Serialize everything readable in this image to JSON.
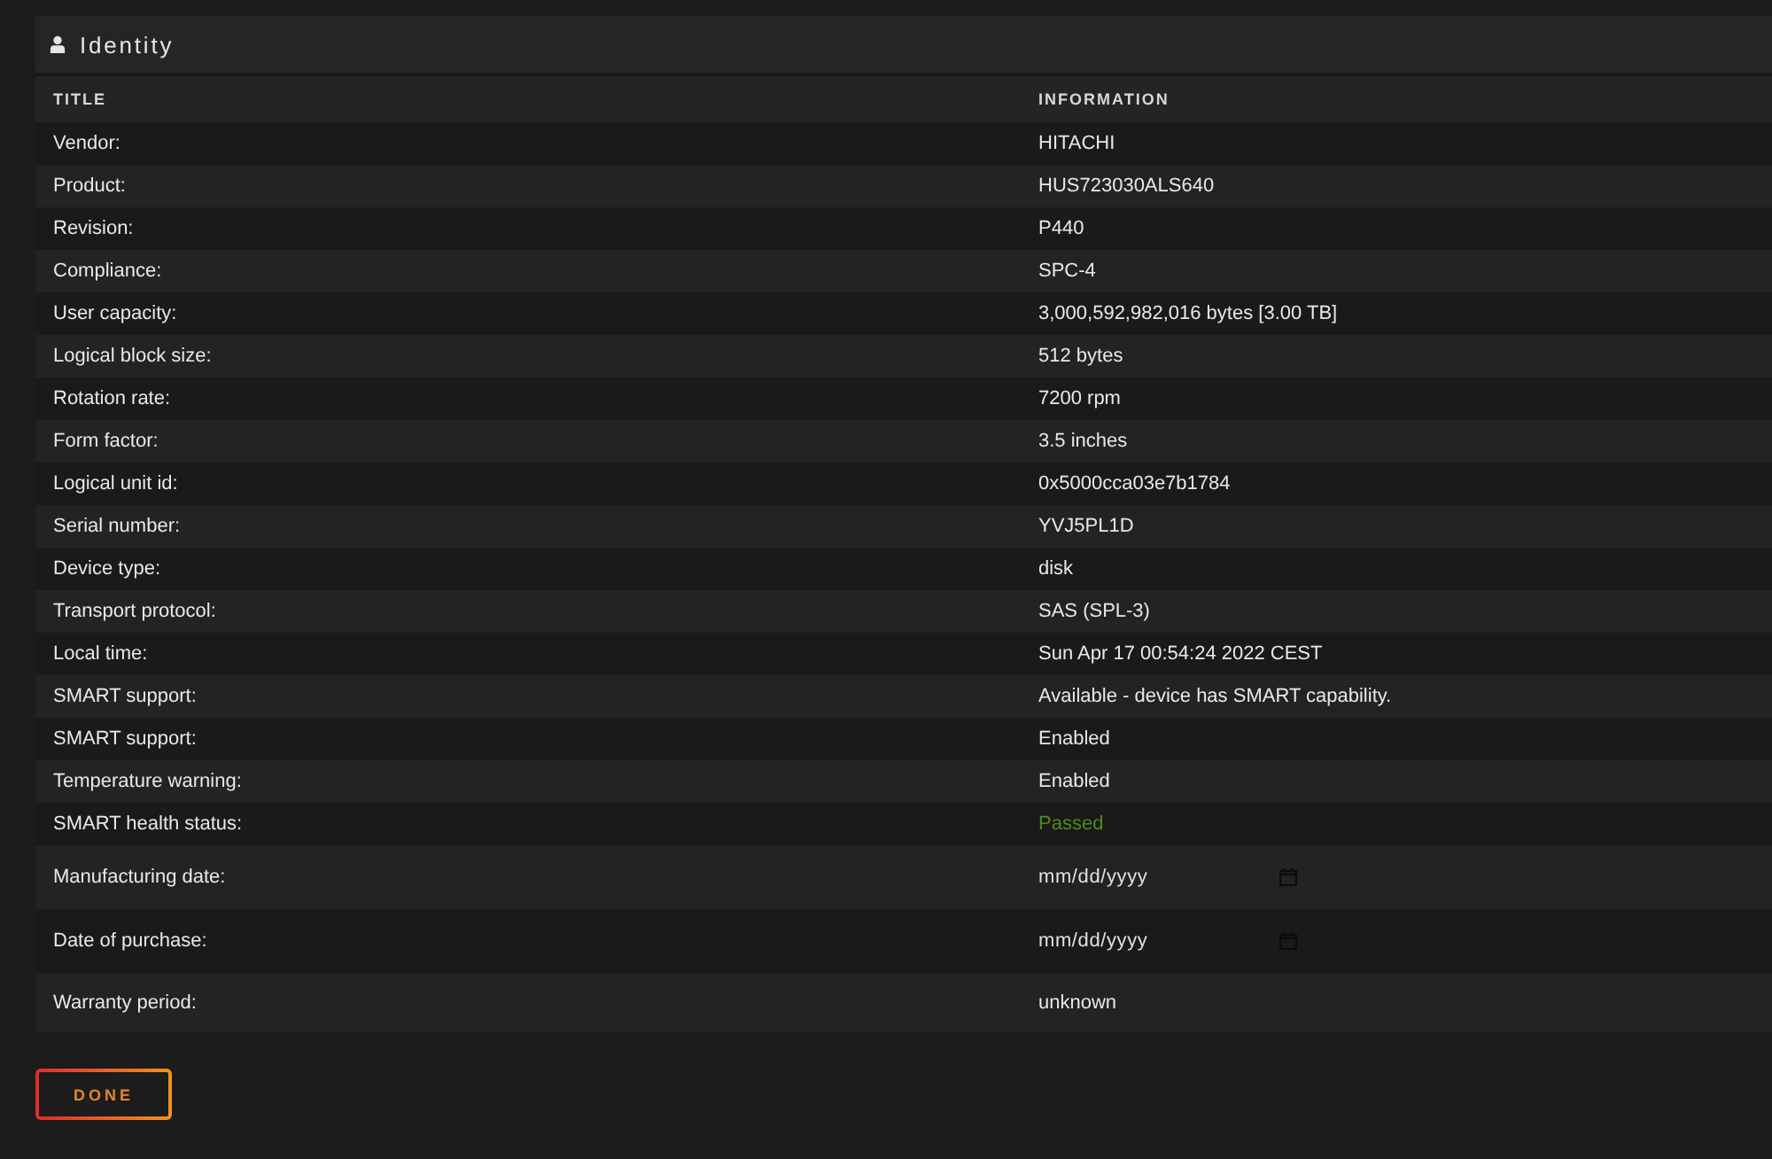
{
  "panel": {
    "title": "Identity"
  },
  "table": {
    "columns": [
      "TITLE",
      "INFORMATION"
    ],
    "rows": [
      {
        "kind": "text",
        "title": "Vendor:",
        "value": "HITACHI"
      },
      {
        "kind": "text",
        "title": "Product:",
        "value": "HUS723030ALS640"
      },
      {
        "kind": "text",
        "title": "Revision:",
        "value": "P440"
      },
      {
        "kind": "text",
        "title": "Compliance:",
        "value": "SPC-4"
      },
      {
        "kind": "text",
        "title": "User capacity:",
        "value": "3,000,592,982,016 bytes [3.00 TB]"
      },
      {
        "kind": "text",
        "title": "Logical block size:",
        "value": "512 bytes"
      },
      {
        "kind": "text",
        "title": "Rotation rate:",
        "value": "7200 rpm"
      },
      {
        "kind": "text",
        "title": "Form factor:",
        "value": "3.5 inches"
      },
      {
        "kind": "text",
        "title": "Logical unit id:",
        "value": "0x5000cca03e7b1784"
      },
      {
        "kind": "text",
        "title": "Serial number:",
        "value": "YVJ5PL1D"
      },
      {
        "kind": "text",
        "title": "Device type:",
        "value": "disk"
      },
      {
        "kind": "text",
        "title": "Transport protocol:",
        "value": "SAS (SPL-3)"
      },
      {
        "kind": "text",
        "title": "Local time:",
        "value": "Sun Apr 17 00:54:24 2022 CEST"
      },
      {
        "kind": "text",
        "title": "SMART support:",
        "value": "Available - device has SMART capability."
      },
      {
        "kind": "text",
        "title": "SMART support:",
        "value": "Enabled"
      },
      {
        "kind": "text",
        "title": "Temperature warning:",
        "value": "Enabled"
      },
      {
        "kind": "text",
        "title": "SMART health status:",
        "value": "Passed",
        "color": "#4e8b1f"
      },
      {
        "kind": "date",
        "title": "Manufacturing date:",
        "placeholder": "mm/dd/yyyy"
      },
      {
        "kind": "date",
        "title": "Date of purchase:",
        "placeholder": "mm/dd/yyyy"
      },
      {
        "kind": "text",
        "title": "Warranty period:",
        "value": "unknown"
      }
    ]
  },
  "buttons": [
    {
      "label": "DONE"
    }
  ]
}
